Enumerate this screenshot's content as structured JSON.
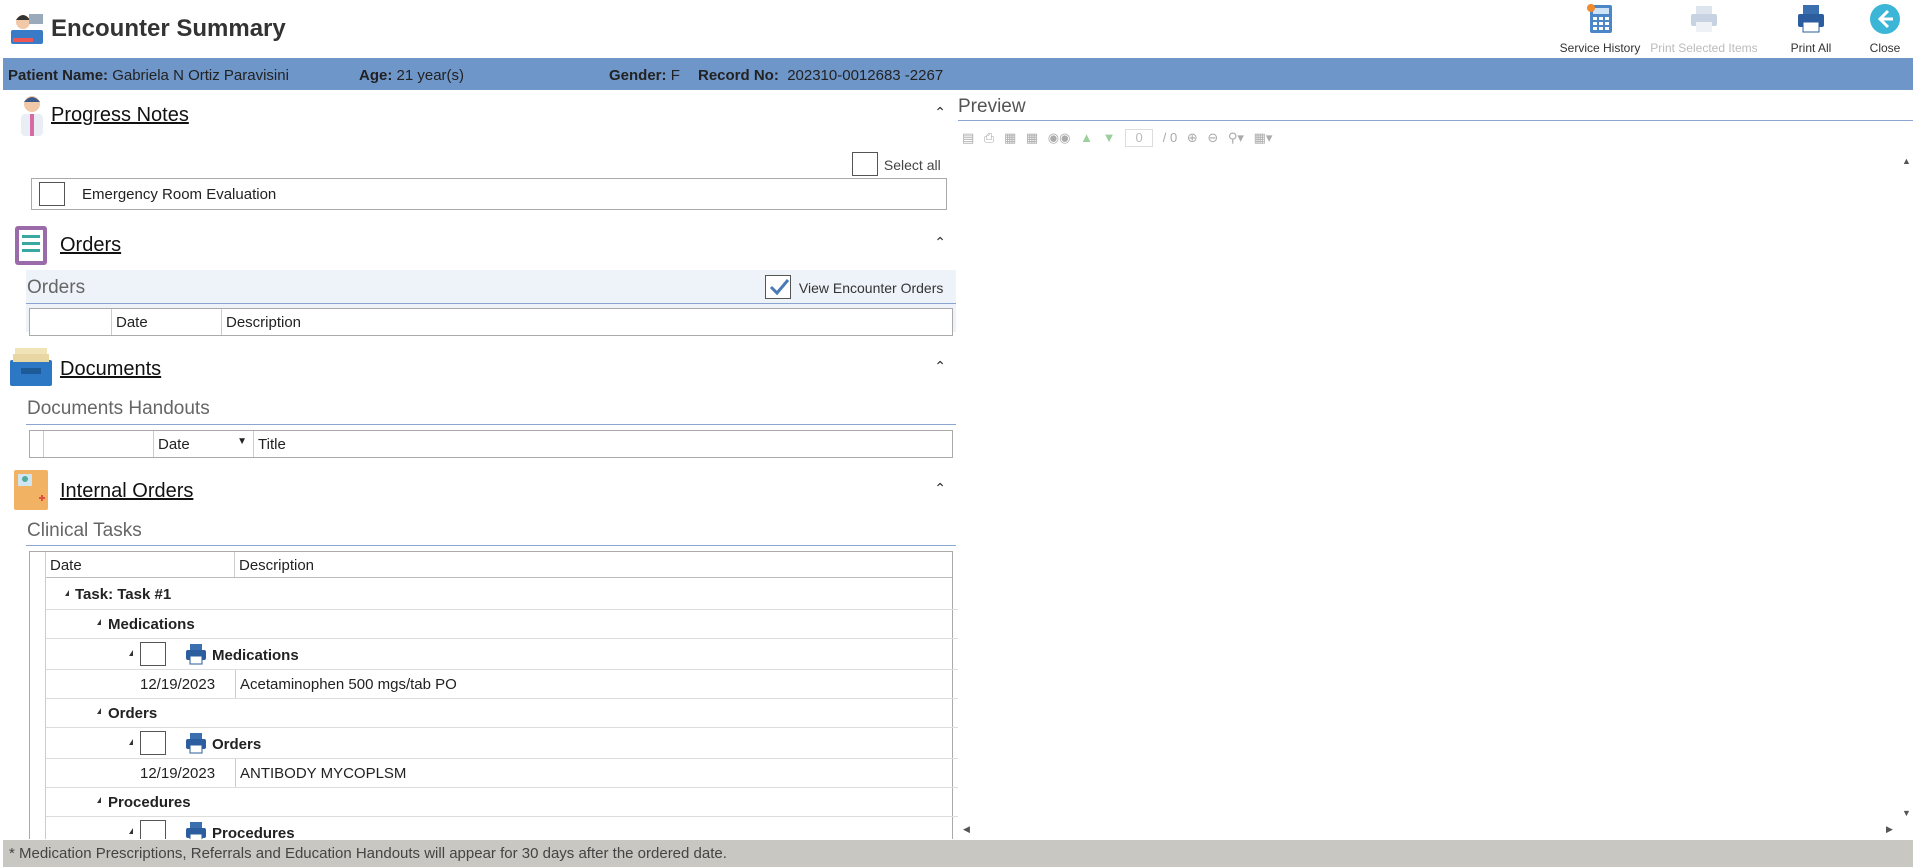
{
  "app": {
    "title": "Encounter Summary"
  },
  "toolbar": {
    "service_history": "Service History",
    "print_selected": "Print Selected Items",
    "print_all": "Print All",
    "close": "Close"
  },
  "patient": {
    "name_label": "Patient Name:",
    "name": "Gabriela N Ortiz Paravisini",
    "age_label": "Age:",
    "age": "21 year(s)",
    "gender_label": "Gender:",
    "gender": "F",
    "record_label": "Record No:",
    "record": "202310-0012683 -2267"
  },
  "progress_notes": {
    "title": "Progress Notes",
    "select_all": "Select all",
    "items": [
      "Emergency Room Evaluation"
    ]
  },
  "orders": {
    "title": "Orders",
    "subtitle": "Orders",
    "view_encounter_orders": "View Encounter Orders",
    "columns": [
      "Date",
      "Description"
    ]
  },
  "documents": {
    "title": "Documents",
    "subtitle": "Documents Handouts",
    "columns": [
      "Date",
      "Title"
    ]
  },
  "internal_orders": {
    "title": "Internal Orders",
    "subtitle": "Clinical Tasks",
    "columns": [
      "Date",
      "Description"
    ],
    "task": "Task: Task #1",
    "groups": [
      {
        "name": "Medications",
        "sub": "Medications",
        "date": "12/19/2023",
        "desc": "Acetaminophen 500 mgs/tab PO"
      },
      {
        "name": "Orders",
        "sub": "Orders",
        "date": "12/19/2023",
        "desc": "ANTIBODY MYCOPLSM"
      },
      {
        "name": "Procedures",
        "sub": "Procedures"
      }
    ]
  },
  "preview": {
    "title": "Preview",
    "page_value": "0",
    "page_total": "/ 0"
  },
  "footer": {
    "note": "* Medication Prescriptions, Referrals and Education Handouts will appear for 30 days after the ordered date."
  }
}
